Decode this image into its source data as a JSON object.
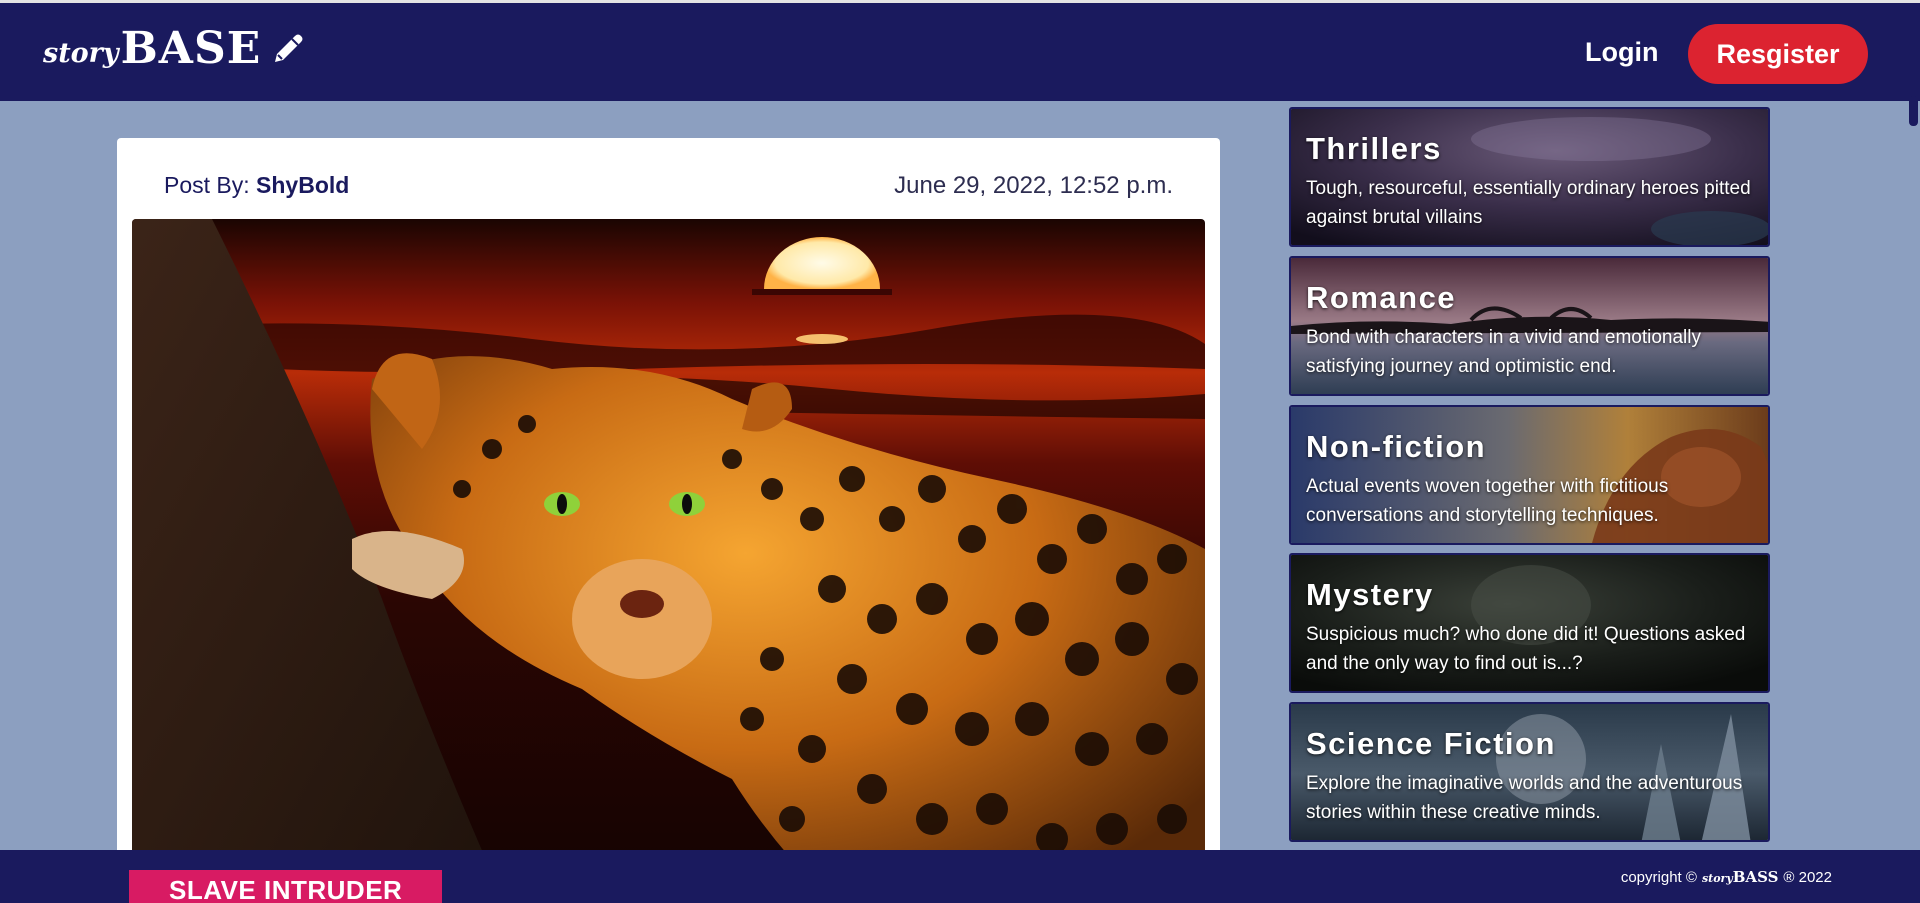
{
  "navbar": {
    "brand_story": "story",
    "brand_base": "BASE",
    "login_label": "Login",
    "register_label": "Resgister"
  },
  "post": {
    "by_label": "Post By:",
    "author": "ShyBold",
    "date": "June 29, 2022, 12:52 p.m.",
    "tag": "SLAVE INTRUDER"
  },
  "categories": [
    {
      "title": "Thrillers",
      "description": "Tough, resourceful, essentially ordinary heroes pitted against brutal villains"
    },
    {
      "title": "Romance",
      "description": "Bond with characters in a vivid and emotionally satisfying journey and optimistic end."
    },
    {
      "title": "Non-fiction",
      "description": "Actual events woven together with fictitious conversations and storytelling techniques."
    },
    {
      "title": "Mystery",
      "description": "Suspicious much? who done did it! Questions asked and the only way to find out is...?"
    },
    {
      "title": "Science Fiction",
      "description": "Explore the imaginative worlds and the adventurous stories within these creative minds."
    }
  ],
  "footer": {
    "copyright_prefix": "copyright ©",
    "brand_story": "story",
    "brand_base": "BASS",
    "copyright_suffix": "® 2022"
  },
  "colors": {
    "navy": "#1a1a5e",
    "register_red": "#dc2330",
    "tag_pink": "#d81b63",
    "page_bg": "#8c9fc0"
  }
}
